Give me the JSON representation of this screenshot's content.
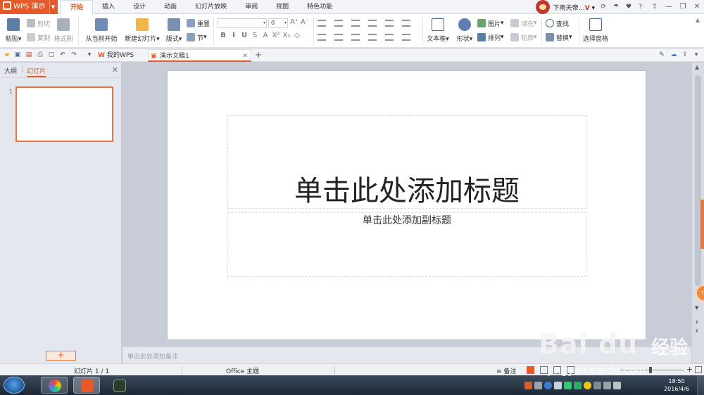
{
  "app": {
    "name": "WPS 演示",
    "accent_color": "#e55a28"
  },
  "menu": {
    "tabs": [
      "开始",
      "插入",
      "设计",
      "动画",
      "幻灯片放映",
      "审阅",
      "视图",
      "特色功能"
    ],
    "active_tab": "开始",
    "user_name": "下雨天帝…",
    "user_level": "V"
  },
  "ribbon": {
    "paste": "粘贴",
    "cut": "剪切",
    "copy": "复制",
    "format_painter": "格式刷",
    "from_current": "从当前开始",
    "new_slide": "新建幻灯片",
    "layout": "版式",
    "reset": "重置",
    "section": "节",
    "font_size": "0",
    "text_box": "文本框",
    "shapes": "形状",
    "picture": "图片",
    "fill": "填充",
    "arrange": "排列",
    "outline": "轮廓",
    "find": "查找",
    "replace": "替换",
    "selection_pane": "选择窗格",
    "format_buttons": [
      "B",
      "I",
      "U",
      "S",
      "A",
      "X²",
      "X₂",
      "◇"
    ]
  },
  "quickbar": {
    "tab_mywps": "我的WPS",
    "tab_doc": "演示文稿1"
  },
  "left_panel": {
    "tab_outline": "大纲",
    "tab_slides": "幻灯片",
    "thumb_number": "1",
    "add_label": "+"
  },
  "slide": {
    "title_placeholder": "单击此处添加标题",
    "subtitle_placeholder": "单击此处添加副标题"
  },
  "notes": {
    "placeholder": "单击此处添加备注"
  },
  "status": {
    "slide_indicator": "幻灯片 1 / 1",
    "theme": "Office 主题",
    "notes_button": "备注"
  },
  "taskbar": {
    "time": "18:50",
    "date": "2016/4/6"
  },
  "watermark": {
    "brand": "Bai du",
    "brand_suffix": "经验",
    "url": "jingyan.baidu.com"
  }
}
